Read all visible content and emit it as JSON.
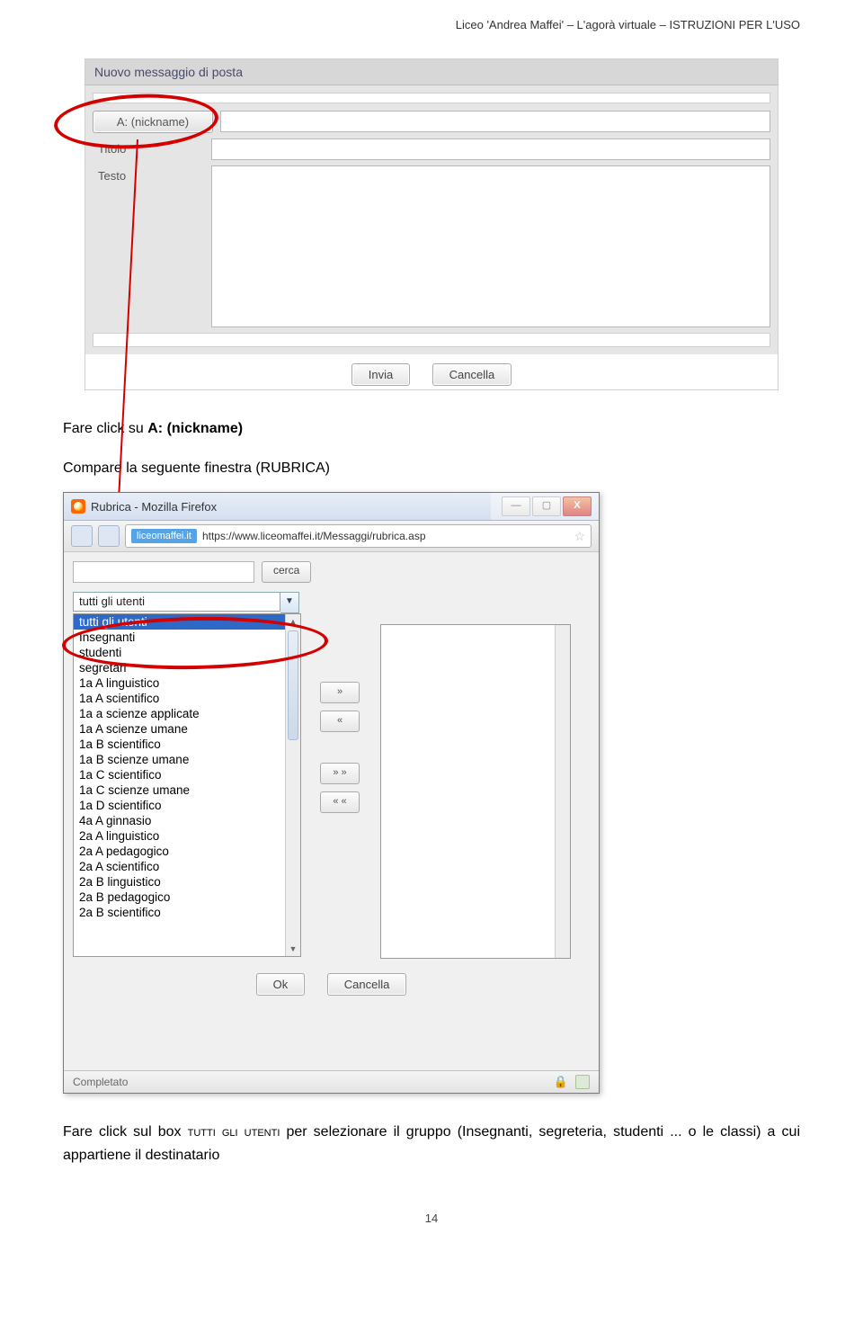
{
  "header": "Liceo 'Andrea Maffei' – L'agorà virtuale – ISTRUZIONI PER L'USO",
  "pageNumber": "14",
  "mail": {
    "title": "Nuovo messaggio di posta",
    "toBtn": "A: (nickname)",
    "titoloLabel": "Titolo",
    "testoLabel": "Testo",
    "send": "Invia",
    "cancel": "Cancella"
  },
  "text1a": "Fare click su ",
  "text1b": "A: (nickname)",
  "text2": "Compare la seguente finestra (RUBRICA)",
  "ff": {
    "title": "Rubrica - Mozilla Firefox",
    "site": "liceomaffei.it",
    "url": "https://www.liceomaffei.it/Messaggi/rubrica.asp",
    "search": "cerca",
    "comboValue": "tutti gli utenti",
    "options": [
      "tutti gli utenti",
      "Insegnanti",
      "studenti",
      "segretari",
      "1a A linguistico",
      "1a A scientifico",
      "1a a scienze applicate",
      "1a A scienze umane",
      "1a B scientifico",
      "1a B scienze umane",
      "1a C scientifico",
      "1a C scienze umane",
      "1a D scientifico",
      "4a A ginnasio",
      "2a A linguistico",
      "2a A pedagogico",
      "2a A scientifico",
      "2a B linguistico",
      "2a B pedagogico",
      "2a B scientifico"
    ],
    "move1": "»",
    "move2": "«",
    "move3": "» »",
    "move4": "« «",
    "ok": "Ok",
    "cancel": "Cancella",
    "status": "Completato"
  },
  "text3a": "Fare click sul box ",
  "text3b": "tutti gli utenti",
  "text3c": " per selezionare il gruppo (Insegnanti, segreteria, studenti ... o le classi) a cui appartiene il destinatario"
}
